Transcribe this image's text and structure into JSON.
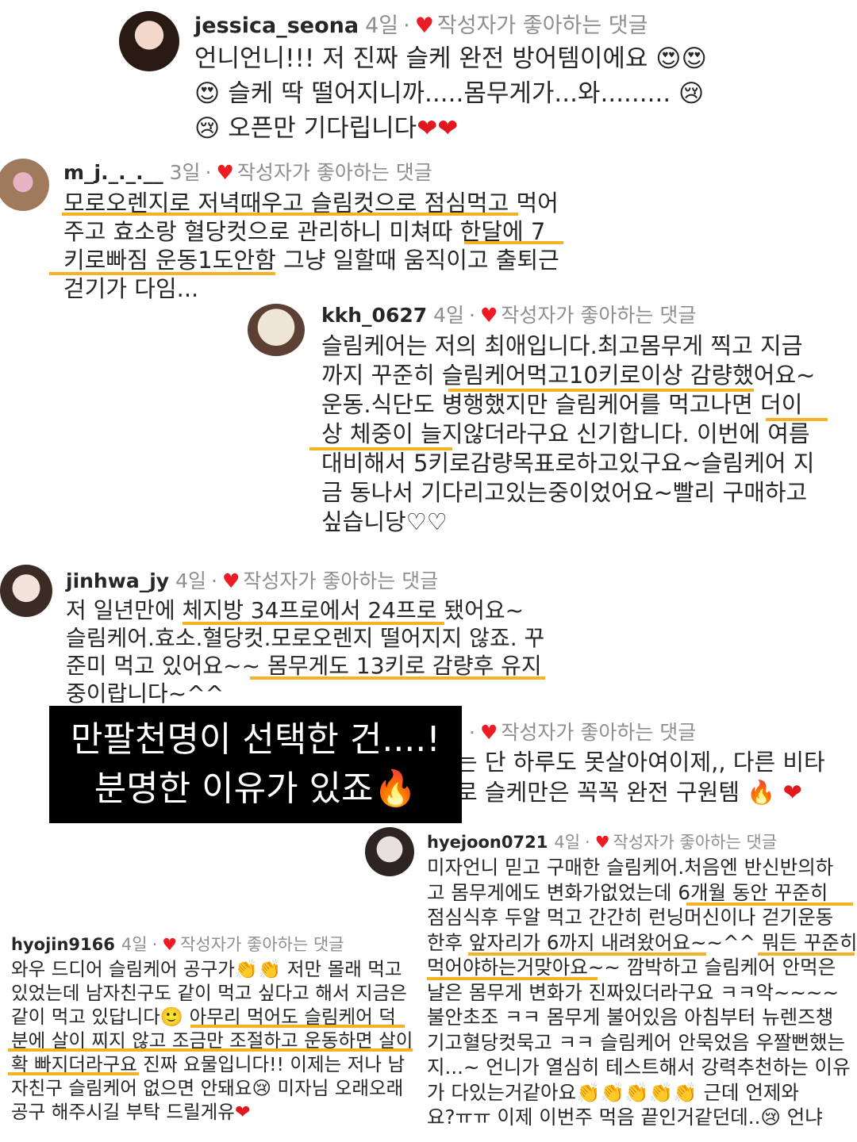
{
  "comments": [
    {
      "user": "jessica_seona",
      "time": "4일",
      "liked": "작성자가 좋아하는 댓글",
      "lines": [
        "언니언니!!! 저 진짜 슬케 완전 방어템이에요",
        "슬케 딱 떨어지니까.....몸무게가...와.........",
        "오픈만 기다립니다"
      ]
    },
    {
      "user": "m_j._._.__",
      "time": "3일",
      "liked": "작성자가 좋아하는 댓글",
      "lines": [
        "모로오렌지로 저녁때우고 슬림컷으로 점심먹고 먹어",
        "주고 효소랑 혈당컷으로 관리하니 미쳐따 한달에 7",
        "키로빠짐 운동1도안함 그냥 일할때 움직이고 출퇴근",
        "걷기가 다임..."
      ]
    },
    {
      "user": "kkh_0627",
      "time": "4일",
      "liked": "작성자가 좋아하는 댓글",
      "lines": [
        "슬림케어는 저의 최애입니다.최고몸무게 찍고  지금",
        "까지 꾸준히 슬림케어먹고10키로이상 감량했어요~",
        "운동.식단도 병행했지만 슬림케어를 먹고나면 더이",
        "상 체중이 늘지않더라구요 신기합니다. 이번에 여름",
        "대비해서 5키로감량목표로하고있구요~슬림케어 지",
        "금 동나서 기다리고있는중이었어요~빨리 구매하고",
        "싶습니당♡♡"
      ]
    },
    {
      "user": "jinhwa_jy",
      "time": "4일",
      "liked": "작성자가 좋아하는 댓글",
      "lines": [
        "저 일년만에  체지방 34프로에서 24프로 됐어요~",
        "슬림케어.효소.혈당컷.모로오렌지 떨어지지 않죠. 꾸",
        "준미 먹고 있어요~~ 몸무게도 13키로 감량후 유지",
        "중이랍니다~^^"
      ]
    },
    {
      "user": "",
      "time": "",
      "liked": "작성자가 좋아하는 댓글",
      "lines": [
        "는 단 하루도 못살아여이제,, 다른 비타",
        "로 슬케만은 꼭꼭 완전 구원템"
      ]
    },
    {
      "user": "hyejoon0721",
      "time": "4일",
      "liked": "작성자가 좋아하는 댓글",
      "lines": [
        "미자언니 믿고 구매한 슬림케어.처음엔 반신반의하",
        "고 몸무게에도 변화가없었는데  6개월 동안 꾸준히",
        "점심식후 두알 먹고 간간히 런닝머신이나 걷기운동",
        "한후 앞자리가 6까지 내려왔어요~~^^ 뭐든 꾸준히",
        "먹어야하는거맞아요~~ 깜박하고 슬림케어  안먹은",
        "날은 몸무게 변화가 진짜있더라구요 ㅋㅋ악~~~~",
        "불안초조 ㅋㅋ 몸무게 불어있음 아침부터 뉴렌즈챙",
        "기고혈당컷묵고 ㅋㅋ 슬림케어 안묵었음 우짤뻔했는",
        "지...~ 언니가 열심히 테스트해서 강력추천하는 이유",
        "가 다있는거같아요",
        "근데 언제와",
        "요?ㅠㅠ 이제 이번주 먹음 끝인거같던데..",
        "언냐"
      ]
    },
    {
      "user": "hyojin9166",
      "time": "4일",
      "liked": "작성자가 좋아하는 댓글",
      "lines": [
        "와우 드디어 슬림케어 공구가",
        "저만 몰래 먹고",
        "있었는데 남자친구도 같이 먹고 싶다고 해서 지금은",
        "같이 먹고 있답니다",
        "아무리 먹어도 슬림케어 덕",
        "분에 살이 찌지 않고 조금만 조절하고 운동하면 살이",
        "확 빠지더라구요 진짜 요물입니다!! 이제는 저나 남",
        "자친구 슬림케어 없으면 안돼요",
        "미자님 오래오래",
        "공구 해주시길 부탁 드릴게유"
      ]
    }
  ],
  "overlay": {
    "line1": "만팔천명이 선택한 건....!",
    "line2": "분명한 이유가 있죠"
  },
  "colors": {
    "highlight": "#f5b225",
    "heart": "#ed1c24"
  },
  "icons": [
    "heart-icon",
    "heart-eyes-emoji",
    "crying-emoji",
    "red-heart-emoji",
    "clapping-emoji",
    "smile-emoji",
    "fire-emoji"
  ]
}
